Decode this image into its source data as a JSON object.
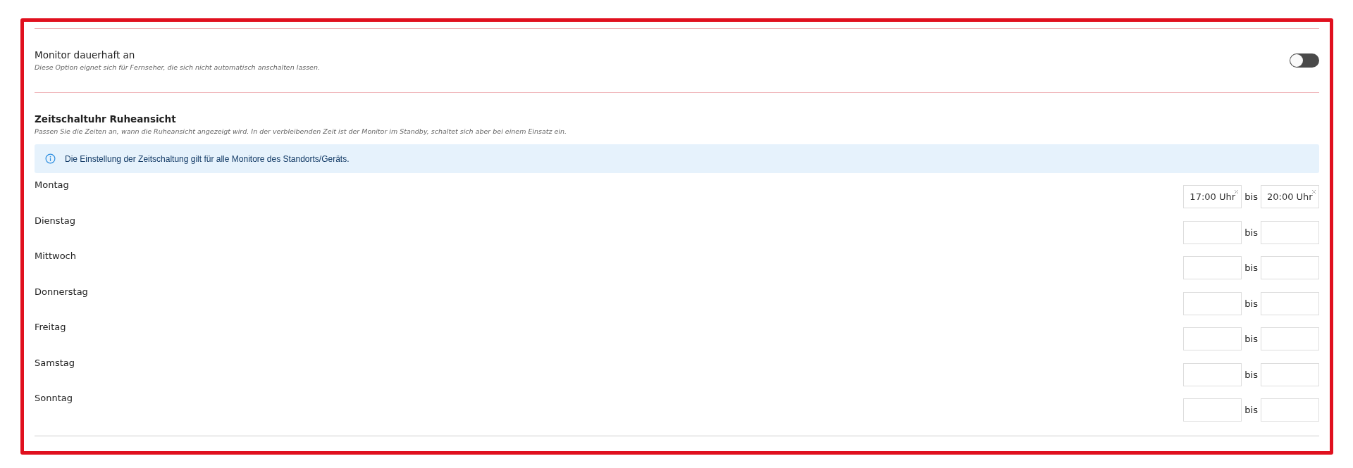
{
  "monitor_setting": {
    "label": "Monitor dauerhaft an",
    "description": "Diese Option eignet sich für Fernseher, die sich nicht automatisch anschalten lassen.",
    "on": false
  },
  "timer": {
    "title": "Zeitschaltuhr Ruheansicht",
    "description": "Passen Sie die Zeiten an, wann die Ruheansicht angezeigt wird. In der verbleibenden Zeit ist der Monitor im Standby, schaltet sich aber bei einem Einsatz ein.",
    "info": "Die Einstellung der Zeitschaltung gilt für alle Monitore des Standorts/Geräts.",
    "days": [
      {
        "day": "Montag",
        "from": "17:00 Uhr",
        "separator": "bis",
        "to": "20:00 Uhr"
      },
      {
        "day": "Dienstag",
        "separator": "bis"
      },
      {
        "day": "Mittwoch",
        "separator": "bis"
      },
      {
        "day": "Donnerstag",
        "separator": "bis"
      },
      {
        "day": "Freitag",
        "separator": "bis"
      },
      {
        "day": "Samstag",
        "separator": "bis"
      },
      {
        "day": "Sonntag",
        "separator": "bis"
      }
    ]
  }
}
